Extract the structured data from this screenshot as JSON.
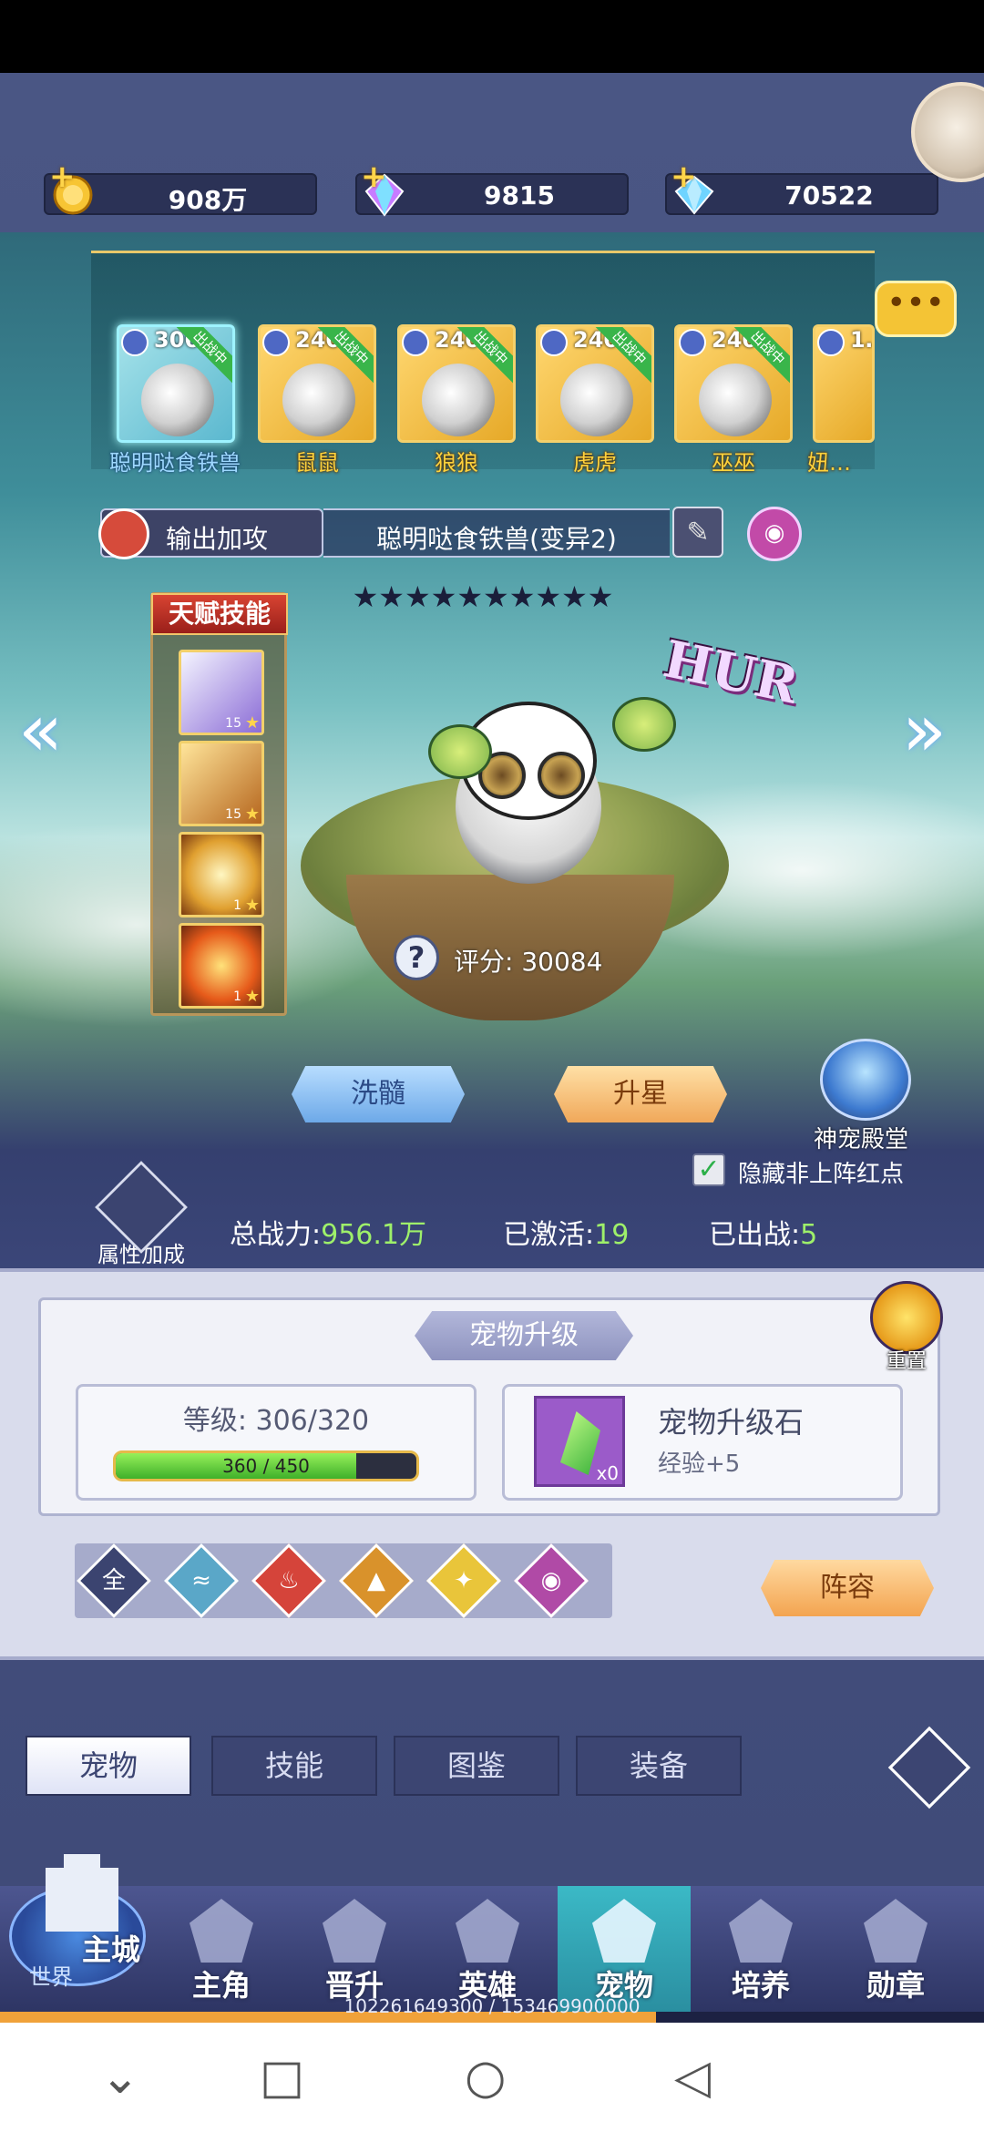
{
  "currency": [
    {
      "icon": "gold-coin-icon",
      "value": "908万"
    },
    {
      "icon": "rainbow-diamond-icon",
      "value": "9815"
    },
    {
      "icon": "blue-diamond-icon",
      "value": "70522"
    }
  ],
  "pets": [
    {
      "level": "306",
      "badge": "出战中",
      "name": "聪明哒食铁兽",
      "selected": true
    },
    {
      "level": "240",
      "badge": "出战中",
      "name": "鼠鼠"
    },
    {
      "level": "240",
      "badge": "出战中",
      "name": "狼狼"
    },
    {
      "level": "240",
      "badge": "出战中",
      "name": "虎虎"
    },
    {
      "level": "240",
      "badge": "出战中",
      "name": "巫巫"
    },
    {
      "level": "1…",
      "badge": "",
      "name": "妞…"
    }
  ],
  "chat_icon": "•••",
  "pet_type": "输出加攻",
  "pet_full_name": "聪明哒食铁兽(变异2)",
  "stars": "★★★★★★★★★★",
  "talent": {
    "title": "天赋技能",
    "skills": [
      {
        "level": "15"
      },
      {
        "level": "15"
      },
      {
        "level": "1"
      },
      {
        "level": "1"
      }
    ]
  },
  "hur_text": "HUR",
  "score": {
    "q": "?",
    "label": "评分: 30084"
  },
  "wash_label": "洗髓",
  "star_up_label": "升星",
  "temple_label": "神宠殿堂",
  "hide_red_label": "隐藏非上阵红点",
  "attr_add_label": "属性加成",
  "stats": {
    "power_label": "总战力:",
    "power_value": "956.1万",
    "activated_label": "已激活:",
    "activated_value": "19",
    "deployed_label": "已出战:",
    "deployed_value": "5"
  },
  "upgrade": {
    "title": "宠物升级",
    "reset_label": "重置",
    "level_label": "等级: 306/320",
    "exp_text": "360 / 450",
    "exp_fraction": 0.8,
    "stone_name": "宠物升级石",
    "stone_exp": "经验+5",
    "stone_count": "x0"
  },
  "filters": [
    "全",
    "",
    "",
    "",
    "",
    ""
  ],
  "lineup_label": "阵容",
  "tabs": [
    "宠物",
    "技能",
    "图鉴",
    "装备"
  ],
  "nav": {
    "castle_main": "主城",
    "castle_world": "世界",
    "items": [
      "主角",
      "晋升",
      "英雄",
      "宠物",
      "培养",
      "勋章"
    ]
  },
  "player_exp_text": "102261649300 / 153469900000",
  "player_exp_fraction": 0.667
}
